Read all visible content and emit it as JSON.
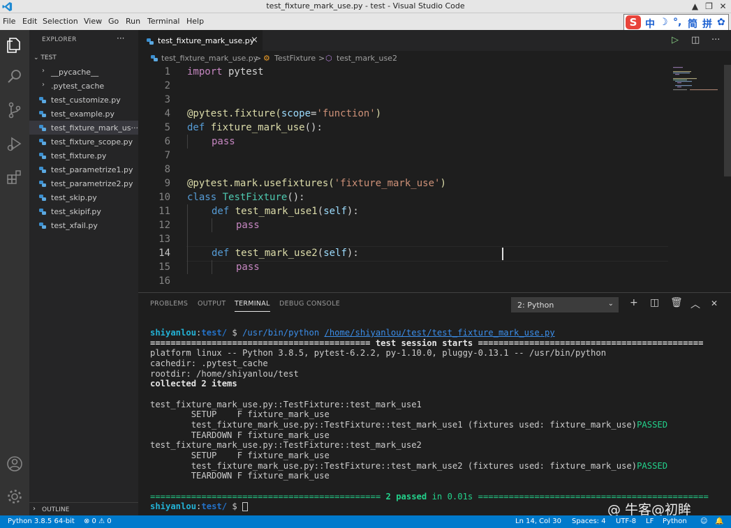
{
  "titlebar": {
    "title": "test_fixture_mark_use.py - test - Visual Studio Code",
    "minimize": "▲",
    "restore": "❐",
    "close": "✕"
  },
  "menu": [
    "File",
    "Edit",
    "Selection",
    "View",
    "Go",
    "Run",
    "Terminal",
    "Help"
  ],
  "ime": {
    "logo": "S",
    "items": [
      "中",
      "☽",
      "°,",
      "简",
      "拼",
      "✿"
    ]
  },
  "activity_bar": [
    "explorer",
    "search",
    "source-control",
    "run-debug",
    "extensions",
    "accounts",
    "manage"
  ],
  "explorer": {
    "header": "EXPLORER",
    "more": "···",
    "root": "TEST",
    "folders": [
      "__pycache__",
      ".pytest_cache"
    ],
    "files": [
      "test_customize.py",
      "test_example.py",
      "test_fixture_mark_use.py",
      "test_fixture_scope.py",
      "test_fixture.py",
      "test_parametrize1.py",
      "test_parametrize2.py",
      "test_skip.py",
      "test_skipif.py",
      "test_xfail.py"
    ],
    "selected_file": "test_fixture_mark_us···",
    "outline": "OUTLINE"
  },
  "editor": {
    "tab_label": "test_fixture_mark_use.py",
    "tab_close": "×",
    "breadcrumb": [
      "test_fixture_mark_use.py",
      "TestFixture",
      "test_mark_use2"
    ],
    "breadcrumb_sep": ">",
    "actions": [
      "▷",
      "◫",
      "···"
    ],
    "line_numbers": [
      "1",
      "2",
      "3",
      "4",
      "5",
      "6",
      "7",
      "8",
      "9",
      "10",
      "11",
      "12",
      "13",
      "14",
      "15",
      "16"
    ],
    "active_line": "14",
    "code": {
      "l1": [
        "import",
        " pytest"
      ],
      "l4": [
        "@pytest.fixture(",
        "scope",
        "=",
        "'function'",
        ")"
      ],
      "l5": [
        "def",
        " ",
        "fixture_mark_use",
        "():"
      ],
      "l6": [
        "pass"
      ],
      "l9": [
        "@pytest.mark.usefixtures(",
        "'fixture_mark_use'",
        ")"
      ],
      "l10": [
        "class",
        " ",
        "TestFixture",
        "():"
      ],
      "l11": [
        "def",
        " ",
        "test_mark_use1",
        "(",
        "self",
        "):"
      ],
      "l12": [
        "pass"
      ],
      "l14": [
        "def",
        " ",
        "test_mark_use2",
        "(",
        "self",
        "):"
      ],
      "l15": [
        "pass"
      ]
    }
  },
  "panel": {
    "tabs": [
      "PROBLEMS",
      "OUTPUT",
      "TERMINAL",
      "DEBUG CONSOLE"
    ],
    "active_tab": "TERMINAL",
    "terminal_select": "2: Python",
    "actions": [
      "+",
      "◫",
      "🗑",
      "︿",
      "✕"
    ],
    "terminal": {
      "prompt_user": "shiyanlou",
      "prompt_sep": ":",
      "prompt_path": "test/",
      "prompt_dollar": " $ ",
      "cmd_python": "/usr/bin/python",
      "cmd_file": "/home/shiyanlou/test/test_fixture_mark_use.py",
      "session_line": "=========================================== test session starts ============================================",
      "platform": "platform linux -- Python 3.8.5, pytest-6.2.2, py-1.10.0, pluggy-0.13.1 -- /usr/bin/python",
      "cachedir": "cachedir: .pytest_cache",
      "rootdir": "rootdir: /home/shiyanlou/test",
      "collected": "collected 2 items",
      "t1_header": "test_fixture_mark_use.py::TestFixture::test_mark_use1",
      "t1_setup": "        SETUP    F fixture_mark_use",
      "t1_test": "        test_fixture_mark_use.py::TestFixture::test_mark_use1 (fixtures used: fixture_mark_use)",
      "t1_teardown": "        TEARDOWN F fixture_mark_use",
      "t2_header": "test_fixture_mark_use.py::TestFixture::test_mark_use2",
      "t2_setup": "        SETUP    F fixture_mark_use",
      "t2_test": "        test_fixture_mark_use.py::TestFixture::test_mark_use2 (fixtures used: fixture_mark_use)",
      "t2_teardown": "        TEARDOWN F fixture_mark_use",
      "passed": "PASSED",
      "summary_left": "============================================= ",
      "summary_passed": "2 passed",
      "summary_time": " in 0.01s ",
      "summary_right": "============================================="
    },
    "watermark": "@ 牛客@初眸"
  },
  "statusbar": {
    "python": "Python 3.8.5 64-bit",
    "problems": "⊗ 0 ⚠ 0",
    "position": "Ln 14, Col 30",
    "spaces": "Spaces: 4",
    "encoding": "UTF-8",
    "eol": "LF",
    "language": "Python",
    "feedback": "☺",
    "bell": "🔔"
  },
  "colors": {
    "statusbar": "#007acc",
    "keyword": "#569cd6",
    "function": "#dcdcaa",
    "string": "#ce9178",
    "class": "#4ec9b0",
    "passed": "#23d18b"
  }
}
